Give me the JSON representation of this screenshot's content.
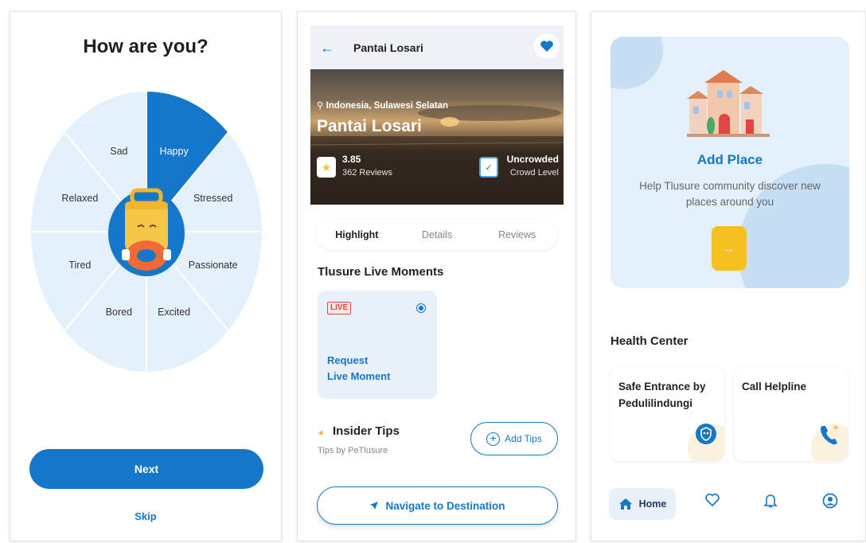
{
  "mood": {
    "title": "How are you?",
    "moods": [
      "Happy",
      "Stressed",
      "Passionate",
      "Excited",
      "Bored",
      "Tired",
      "Relaxed",
      "Sad"
    ],
    "selected": "Happy",
    "next_label": "Next",
    "skip_label": "Skip",
    "colors": {
      "accent": "#1477c9",
      "wheel": "#e4f0fb"
    }
  },
  "detail": {
    "header_title": "Pantai Losari",
    "location": "Indonesia, Sulawesi Selatan",
    "place_name": "Pantai Losari",
    "rating": "3.85",
    "reviews": "362 Reviews",
    "crowd_value": "Uncrowded",
    "crowd_label": "Crowd Level",
    "tabs": [
      "Highlight",
      "Details",
      "Reviews"
    ],
    "active_tab": "Highlight",
    "live_section_title": "Tlusure Live Moments",
    "live_badge": "LIVE",
    "live_card_label": "Request\nLive Moment",
    "tips_title": "Insider Tips",
    "tips_subtitle": "Tips by PeTlusure",
    "add_tips_label": "Add Tips",
    "navigate_label": "Navigate to Destination",
    "icons": [
      "back-arrow-icon",
      "heart-icon",
      "location-pin-icon",
      "star-icon",
      "crowd-check-icon",
      "radio-icon",
      "lightbulb-icon",
      "plus-circle-icon",
      "navigate-icon"
    ]
  },
  "home": {
    "add_place_title": "Add Place",
    "add_place_subtitle": "Help Tlusure community discover new places around you",
    "health_title": "Health Center",
    "cards": [
      {
        "title": "Safe Entrance by Pedulilindungi",
        "icon": "shield-icon"
      },
      {
        "title": "Call Helpline",
        "icon": "phone-icon"
      }
    ],
    "nav": {
      "home_label": "Home",
      "icons": [
        "home-icon",
        "heart-outline-icon",
        "bell-icon",
        "profile-icon"
      ]
    }
  }
}
